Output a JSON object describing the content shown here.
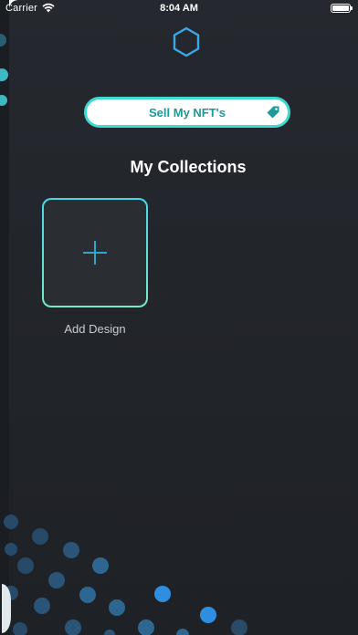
{
  "status_bar": {
    "carrier": "Carrier",
    "time": "8:04 AM"
  },
  "header": {
    "logo_icon": "hexagon-icon",
    "sell_button_label": "Sell My NFT's",
    "sell_button_icon": "tag-icon"
  },
  "collections": {
    "title": "My Collections",
    "add_design_label": "Add Design",
    "add_design_icon": "plus-icon"
  },
  "colors": {
    "background": "#23272c",
    "accent": "#3fd9d0",
    "button_text": "#1a9a98",
    "dot_blue": "#2e8fe0"
  }
}
